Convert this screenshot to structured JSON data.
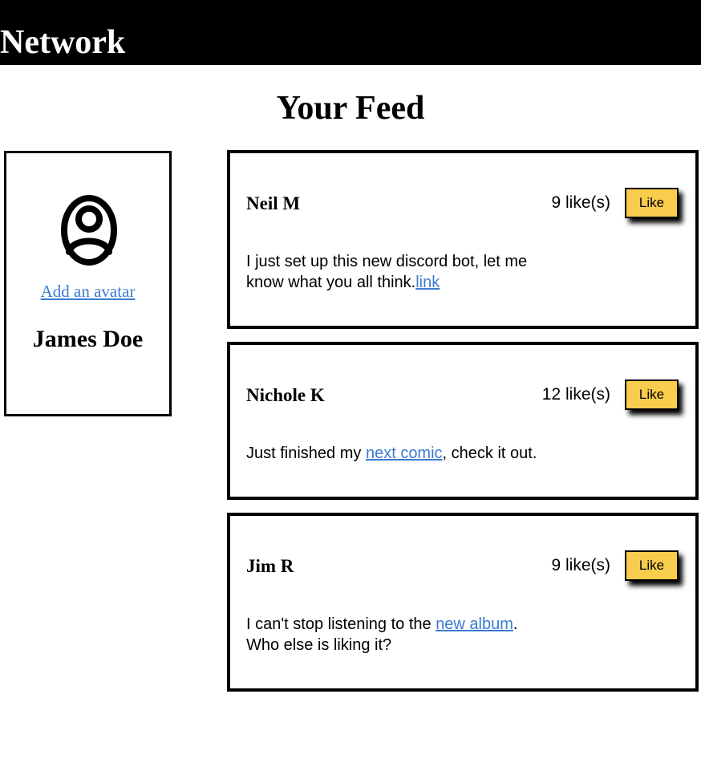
{
  "header": {
    "brand": "Network"
  },
  "page": {
    "title": "Your Feed"
  },
  "profile": {
    "avatar_icon": "user-avatar-icon",
    "add_avatar_label": "Add an avatar",
    "name": "James Doe"
  },
  "posts": [
    {
      "author": "Neil M",
      "likes": "9 like(s)",
      "like_label": "Like",
      "body_line1": "I just set up this new discord bot, let me",
      "body_line2_text": "know what you all think.",
      "link_text": "link"
    },
    {
      "author": "Nichole K",
      "likes": "12 like(s)",
      "like_label": "Like",
      "body_before": "Just finished my ",
      "link_text": "next comic",
      "body_after": ", check it out."
    },
    {
      "author": "Jim R",
      "likes": "9 like(s)",
      "like_label": "Like",
      "body_before": "I can't stop listening to the ",
      "link_text": "new album",
      "body_after": ".",
      "body_line2": "Who else is liking it?"
    }
  ],
  "colors": {
    "header_bg": "#000000",
    "link": "#3d7bd2",
    "like_button": "#f8cc4c"
  }
}
